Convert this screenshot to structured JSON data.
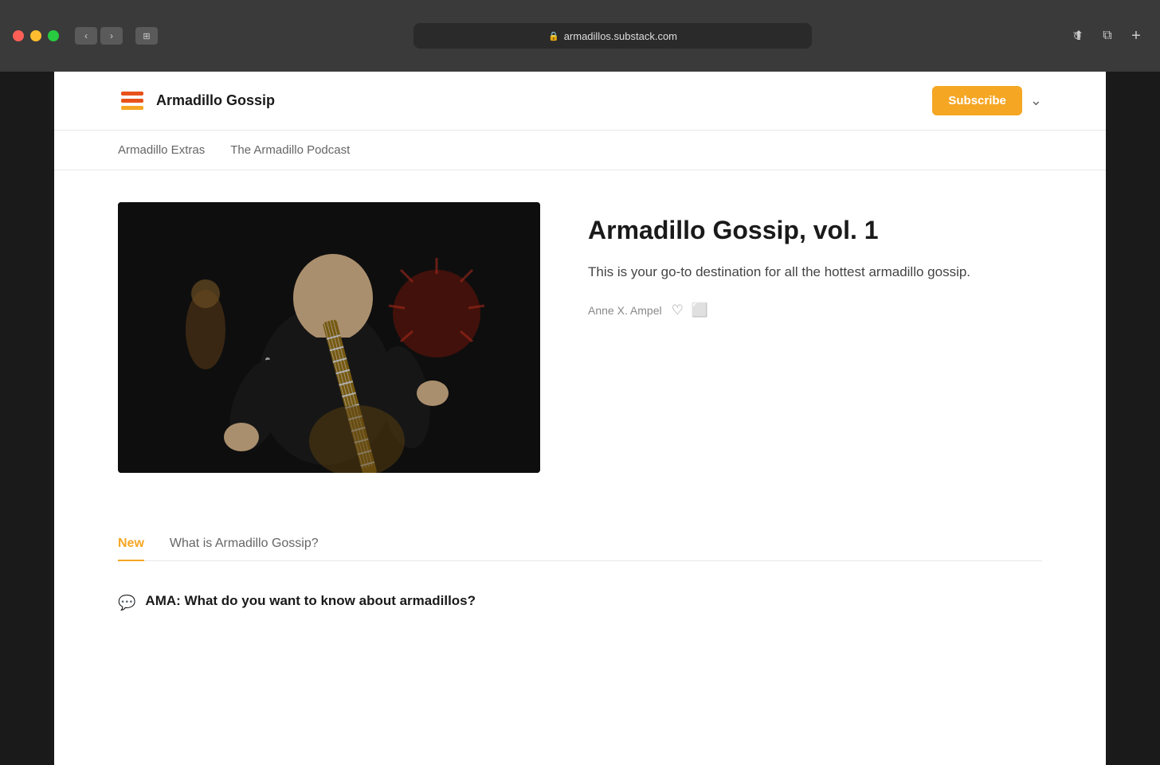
{
  "browser": {
    "url": "armadillos.substack.com",
    "back_label": "‹",
    "forward_label": "›",
    "tab_label": "⊞",
    "reload_label": "↻",
    "share_label": "↑",
    "tabs_label": "⧉",
    "new_tab_label": "+"
  },
  "header": {
    "brand_name": "Armadillo Gossip",
    "subscribe_label": "Subscribe",
    "chevron_label": "⌄"
  },
  "nav": {
    "items": [
      {
        "label": "Armadillo Extras",
        "active": false
      },
      {
        "label": "The Armadillo Podcast",
        "active": false
      }
    ]
  },
  "featured": {
    "title": "Armadillo Gossip, vol. 1",
    "description": "This is your go-to destination for all the hottest armadillo gossip.",
    "author": "Anne X. Ampel",
    "like_icon": "♡",
    "share_icon": "⎙"
  },
  "tabs": {
    "items": [
      {
        "label": "New",
        "active": true
      },
      {
        "label": "What is Armadillo Gossip?",
        "active": false
      }
    ]
  },
  "posts": [
    {
      "icon": "💬",
      "title": "AMA: What do you want to know about armadillos?"
    }
  ]
}
